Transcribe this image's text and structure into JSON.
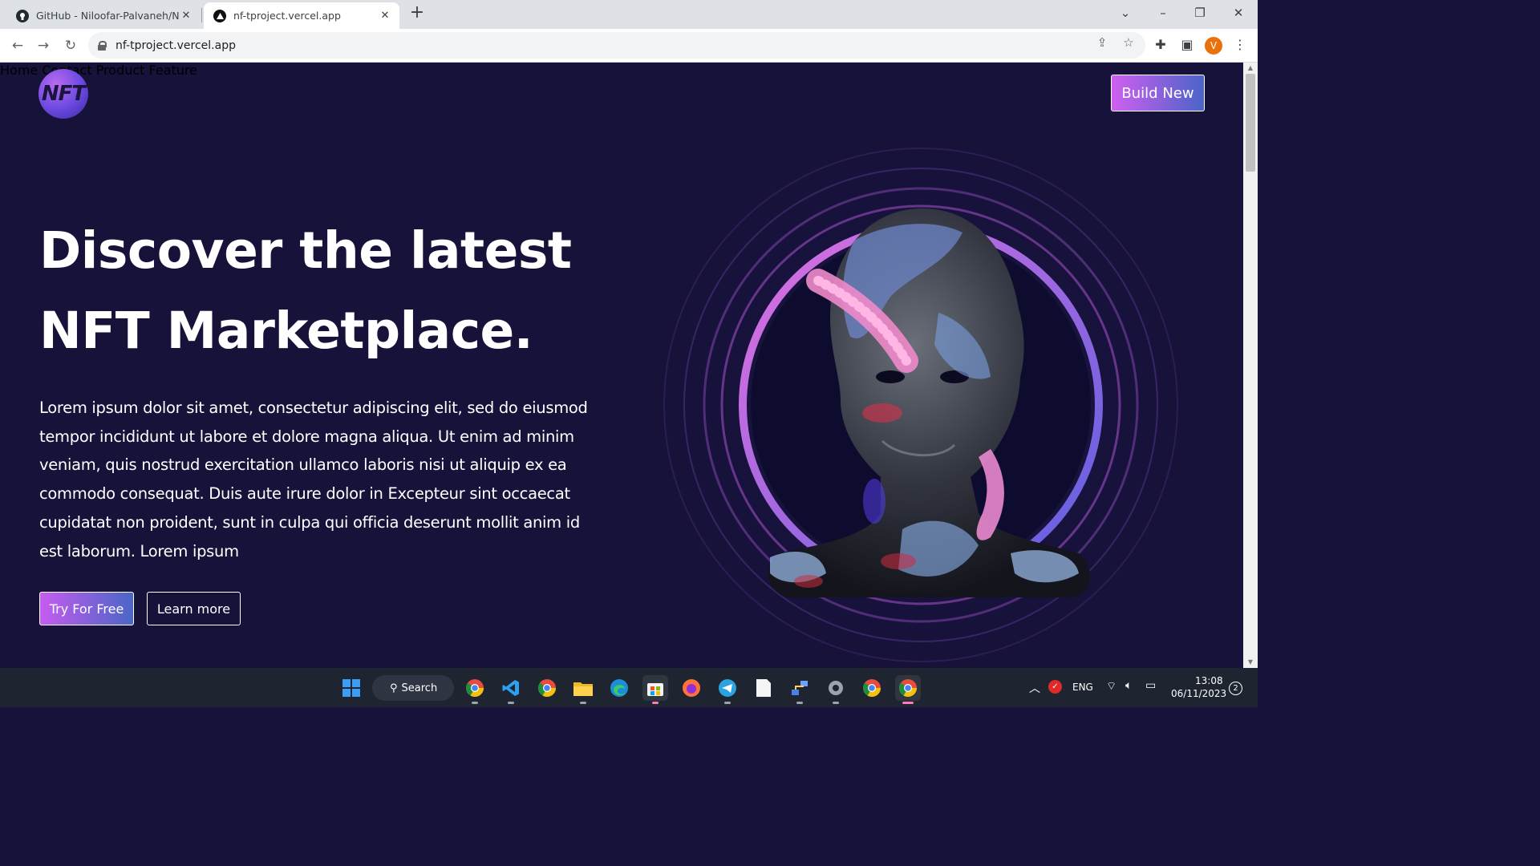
{
  "browser": {
    "tabs": [
      {
        "title": "GitHub - Niloofar-Palvaneh/NFT..."
      },
      {
        "title": "nf-tproject.vercel.app"
      }
    ],
    "new_tab_label": "+",
    "url": "nf-tproject.vercel.app",
    "profile_initial": "V"
  },
  "page": {
    "logo_text": "NFT",
    "nav": [
      "Home",
      "Contact",
      "Product",
      "Feature"
    ],
    "cta_button": "Build New",
    "headline_line1": "Discover the latest",
    "headline_line2": "NFT Marketplace.",
    "lead": "Lorem ipsum dolor sit amet, consectetur adipiscing elit, sed do eiusmod tempor incididunt ut labore et dolore magna aliqua. Ut enim ad minim veniam, quis nostrud exercitation ullamco laboris nisi ut aliquip ex ea commodo consequat. Duis aute irure dolor in Excepteur sint occaecat cupidatat non proident, sunt in culpa qui officia deserunt mollit anim id est laborum. Lorem ipsum",
    "primary_button": "Try For Free",
    "secondary_button": "Learn more"
  },
  "taskbar": {
    "search_label": "Search",
    "language": "ENG",
    "time": "13:08",
    "date": "06/11/2023",
    "notification_count": "2"
  },
  "colors": {
    "page_bg": "#16123a",
    "accent_gradient_start": "#c55cf0",
    "accent_gradient_end": "#4a66c6"
  }
}
